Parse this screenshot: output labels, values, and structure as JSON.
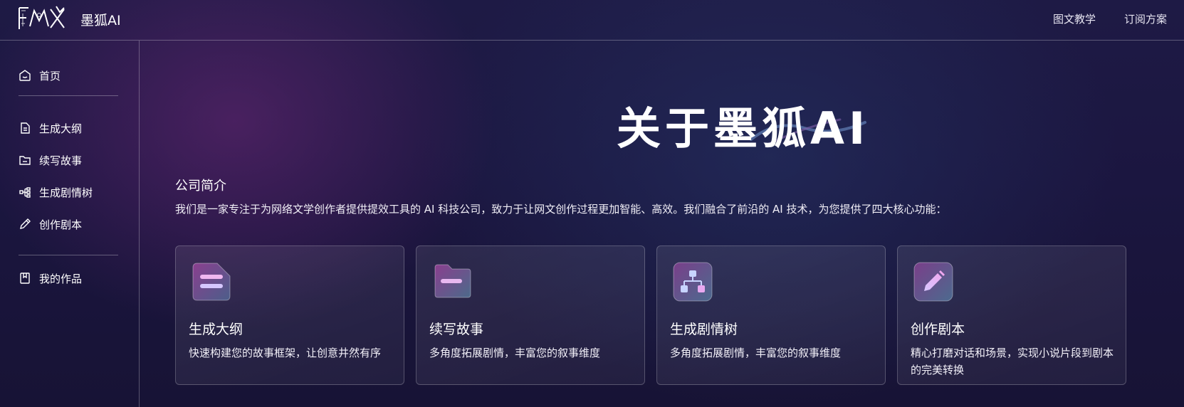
{
  "header": {
    "brand": "墨狐AI",
    "nav": [
      "图文教学",
      "订阅方案"
    ]
  },
  "sidebar": {
    "items": [
      {
        "label": "首页",
        "icon": "home-icon"
      },
      {
        "label": "生成大纲",
        "icon": "document-icon"
      },
      {
        "label": "续写故事",
        "icon": "folder-icon"
      },
      {
        "label": "生成剧情树",
        "icon": "tree-icon"
      },
      {
        "label": "创作剧本",
        "icon": "pencil-icon"
      },
      {
        "label": "我的作品",
        "icon": "bookmark-book-icon"
      }
    ]
  },
  "main": {
    "hero_title": "关于墨狐AI",
    "section_title": "公司简介",
    "section_desc": "我们是一家专注于为网络文学创作者提供提效工具的 AI 科技公司，致力于让网文创作过程更加智能、高效。我们融合了前沿的 AI 技术，为您提供了四大核心功能：",
    "cards": [
      {
        "title": "生成大纲",
        "desc": "快速构建您的故事框架，让创意井然有序",
        "icon": "document-lines-icon"
      },
      {
        "title": "续写故事",
        "desc": "多角度拓展剧情，丰富您的叙事维度",
        "icon": "folder-icon"
      },
      {
        "title": "生成剧情树",
        "desc": "多角度拓展剧情，丰富您的叙事维度",
        "icon": "tree-structure-icon"
      },
      {
        "title": "创作剧本",
        "desc": "精心打磨对话和场景，实现小说片段到剧本的完美转换",
        "icon": "pencil-icon"
      }
    ]
  },
  "colors": {
    "accent_pink": "#e6a6e8",
    "accent_purple": "#b89cf0",
    "bg_dark": "#1b1640"
  }
}
